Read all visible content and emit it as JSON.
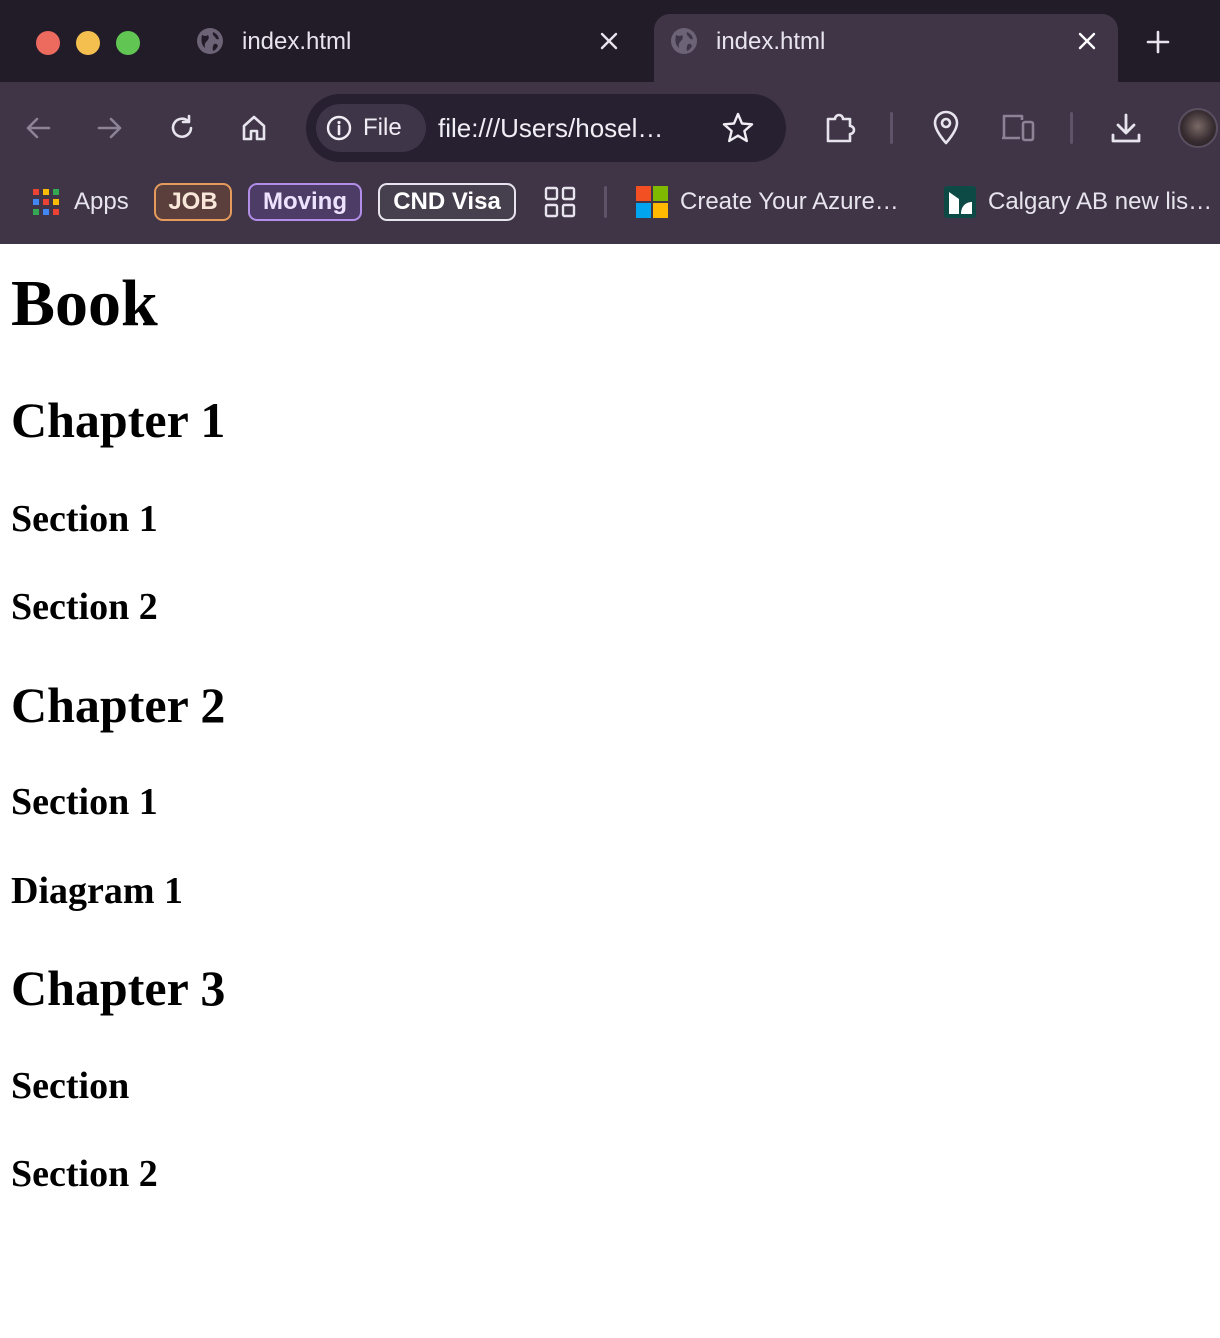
{
  "browser": {
    "tabs": [
      {
        "title": "index.html",
        "active": false
      },
      {
        "title": "index.html",
        "active": true
      }
    ],
    "omnibox": {
      "scheme_chip": "File",
      "url": "file:///Users/hosel…"
    },
    "bookmarks": {
      "apps_label": "Apps",
      "folders": [
        "JOB",
        "Moving",
        "CND Visa"
      ],
      "links": [
        "Create Your Azure…",
        "Calgary AB new lis…"
      ]
    },
    "colors": {
      "tab_strip": "#221c29",
      "toolbar": "#3f3547",
      "omnibox": "#262030",
      "job_folder_border": "#e59b5c",
      "moving_folder_border": "#b38ee9"
    }
  },
  "page": {
    "title": "Book",
    "outline": [
      "Chapter 1",
      "Section 1",
      "Section 2",
      "Chapter 2",
      "Section 1",
      "Diagram 1",
      "Chapter 3",
      "Section",
      "Section 2"
    ]
  }
}
